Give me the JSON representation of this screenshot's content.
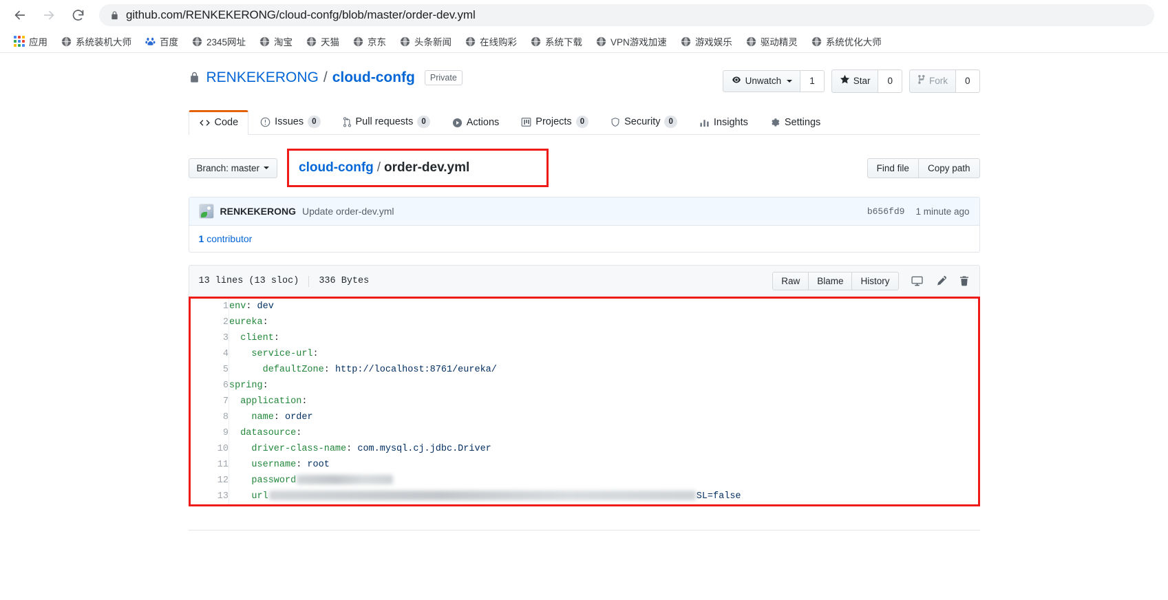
{
  "browser": {
    "back_label": "Back",
    "forward_label": "Forward",
    "reload_label": "Reload",
    "url": "github.com/RENKEKERONG/cloud-confg/blob/master/order-dev.yml",
    "security_icon": "lock-icon",
    "bookmarks": [
      {
        "icon": "apps-grid-icon",
        "label": "应用"
      },
      {
        "icon": "globe-icon",
        "label": "系统装机大师"
      },
      {
        "icon": "baidu-icon",
        "label": "百度"
      },
      {
        "icon": "globe-icon",
        "label": "2345网址"
      },
      {
        "icon": "globe-icon",
        "label": "淘宝"
      },
      {
        "icon": "globe-icon",
        "label": "天猫"
      },
      {
        "icon": "globe-icon",
        "label": "京东"
      },
      {
        "icon": "globe-icon",
        "label": "头条新闻"
      },
      {
        "icon": "globe-icon",
        "label": "在线购彩"
      },
      {
        "icon": "globe-icon",
        "label": "系统下载"
      },
      {
        "icon": "globe-icon",
        "label": "VPN游戏加速"
      },
      {
        "icon": "globe-icon",
        "label": "游戏娱乐"
      },
      {
        "icon": "globe-icon",
        "label": "驱动精灵"
      },
      {
        "icon": "globe-icon",
        "label": "系统优化大师"
      }
    ]
  },
  "repo": {
    "visibility_icon": "lock-icon",
    "owner": "RENKEKERONG",
    "separator": "/",
    "name": "cloud-confg",
    "visibility_badge": "Private",
    "actions": {
      "watch_label": "Unwatch",
      "watch_count": "1",
      "star_label": "Star",
      "star_count": "0",
      "fork_label": "Fork",
      "fork_count": "0"
    }
  },
  "tabs": [
    {
      "label": "Code",
      "icon": "code-icon",
      "count": "",
      "active": true
    },
    {
      "label": "Issues",
      "icon": "issue-opened-icon",
      "count": "0",
      "active": false
    },
    {
      "label": "Pull requests",
      "icon": "git-pull-request-icon",
      "count": "0",
      "active": false
    },
    {
      "label": "Actions",
      "icon": "play-icon",
      "count": "",
      "active": false
    },
    {
      "label": "Projects",
      "icon": "project-icon",
      "count": "0",
      "active": false
    },
    {
      "label": "Security",
      "icon": "shield-icon",
      "count": "0",
      "active": false
    },
    {
      "label": "Insights",
      "icon": "graph-icon",
      "count": "",
      "active": false
    },
    {
      "label": "Settings",
      "icon": "gear-icon",
      "count": "",
      "active": false
    }
  ],
  "file_nav": {
    "branch_label": "Branch: master",
    "breadcrumb_repo": "cloud-confg",
    "breadcrumb_sep": "/",
    "breadcrumb_file": "order-dev.yml",
    "find_file_label": "Find file",
    "copy_path_label": "Copy path"
  },
  "commit": {
    "author": "RENKEKERONG",
    "message": "Update order-dev.yml",
    "sha": "b656fd9",
    "time": "1 minute ago",
    "contributors_count": "1",
    "contributors_label": "contributor"
  },
  "blob": {
    "lines_text": "13 lines (13 sloc)",
    "size_text": "336 Bytes",
    "raw_label": "Raw",
    "blame_label": "Blame",
    "history_label": "History",
    "desktop_icon": "device-desktop-icon",
    "edit_icon": "pencil-icon",
    "delete_icon": "trash-icon"
  },
  "code": {
    "language": "yaml",
    "lines": [
      {
        "n": "1",
        "indent": 0,
        "key": "env",
        "sep": ": ",
        "value": "dev",
        "redacted": false
      },
      {
        "n": "2",
        "indent": 0,
        "key": "eureka",
        "sep": ":",
        "value": "",
        "redacted": false
      },
      {
        "n": "3",
        "indent": 1,
        "key": "client",
        "sep": ":",
        "value": "",
        "redacted": false
      },
      {
        "n": "4",
        "indent": 2,
        "key": "service-url",
        "sep": ":",
        "value": "",
        "redacted": false
      },
      {
        "n": "5",
        "indent": 3,
        "key": "defaultZone",
        "sep": ": ",
        "value": "http://localhost:8761/eureka/",
        "redacted": false
      },
      {
        "n": "6",
        "indent": 0,
        "key": "spring",
        "sep": ":",
        "value": "",
        "redacted": false
      },
      {
        "n": "7",
        "indent": 1,
        "key": "application",
        "sep": ":",
        "value": "",
        "redacted": false
      },
      {
        "n": "8",
        "indent": 2,
        "key": "name",
        "sep": ": ",
        "value": "order",
        "redacted": false
      },
      {
        "n": "9",
        "indent": 1,
        "key": "datasource",
        "sep": ":",
        "value": "",
        "redacted": false
      },
      {
        "n": "10",
        "indent": 2,
        "key": "driver-class-name",
        "sep": ": ",
        "value": "com.mysql.cj.jdbc.Driver",
        "redacted": false
      },
      {
        "n": "11",
        "indent": 2,
        "key": "username",
        "sep": ": ",
        "value": "root",
        "redacted": false
      },
      {
        "n": "12",
        "indent": 2,
        "key": "password",
        "sep": "",
        "value": "",
        "redacted": true,
        "redact_width": 140
      },
      {
        "n": "13",
        "indent": 2,
        "key": "url",
        "sep": "",
        "value": "SL=false",
        "redacted": true,
        "redact_width": 620
      }
    ]
  },
  "annotations": {
    "highlight_color": "#ee1c19",
    "boxes": [
      "breadcrumb-highlight",
      "code-block-highlight"
    ]
  }
}
